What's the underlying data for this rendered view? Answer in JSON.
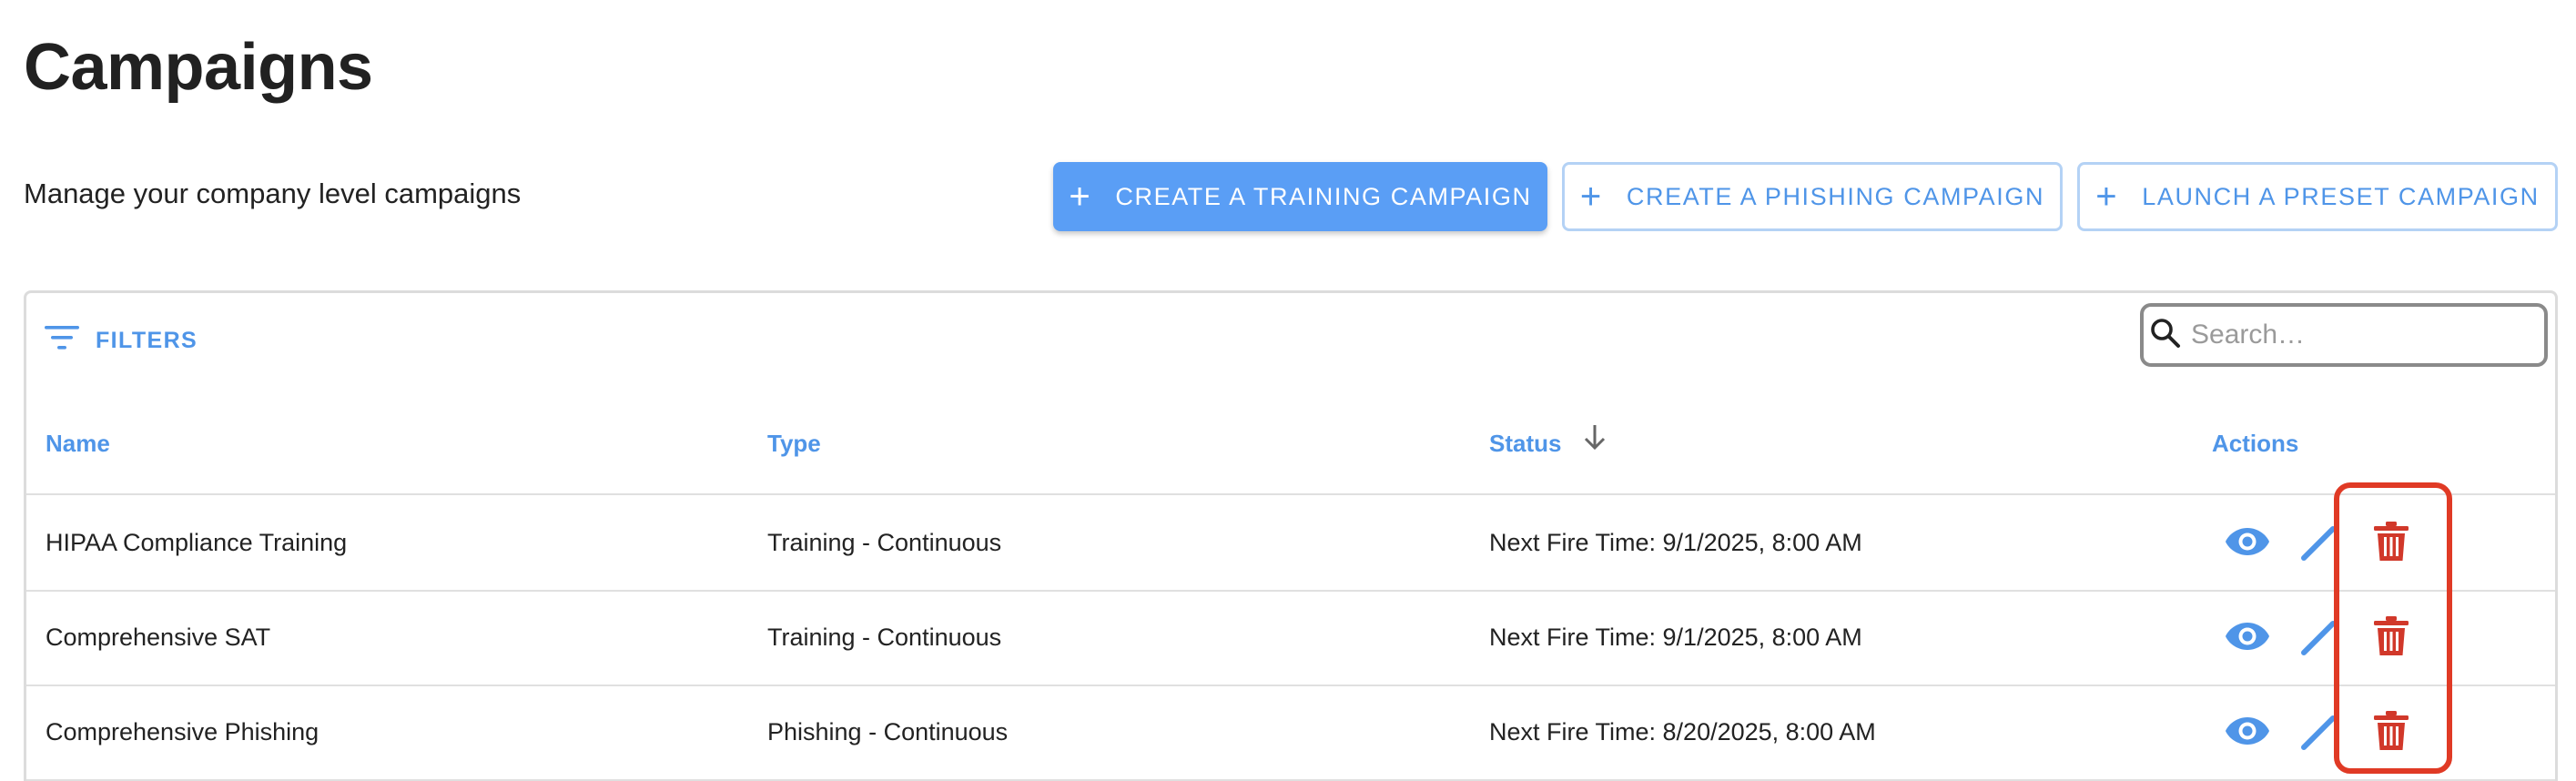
{
  "page": {
    "title": "Campaigns",
    "subtitle": "Manage your company level campaigns"
  },
  "toolbar": {
    "create_training_label": "CREATE A TRAINING CAMPAIGN",
    "create_phishing_label": "CREATE A PHISHING CAMPAIGN",
    "launch_preset_label": "LAUNCH A PRESET CAMPAIGN",
    "plus_glyph": "+"
  },
  "table": {
    "filters_label": "FILTERS",
    "search": {
      "placeholder": "Search…",
      "value": ""
    },
    "columns": {
      "name": "Name",
      "type": "Type",
      "status": "Status",
      "actions": "Actions"
    },
    "sort": {
      "column": "Status",
      "direction": "descending"
    },
    "rows": [
      {
        "name": "HIPAA Compliance Training",
        "type": "Training - Continuous",
        "status": "Next Fire Time: 9/1/2025, 8:00 AM"
      },
      {
        "name": "Comprehensive SAT",
        "type": "Training - Continuous",
        "status": "Next Fire Time: 9/1/2025, 8:00 AM"
      },
      {
        "name": "Comprehensive Phishing",
        "type": "Phishing - Continuous",
        "status": "Next Fire Time: 8/20/2025, 8:00 AM"
      }
    ],
    "action_icons": [
      "eye-icon",
      "pencil-icon",
      "trash-icon"
    ]
  },
  "colors": {
    "accent": "#4f95e8",
    "primary_button": "#5a9ef5",
    "delete": "#d1382a",
    "highlight": "#e03a25"
  }
}
